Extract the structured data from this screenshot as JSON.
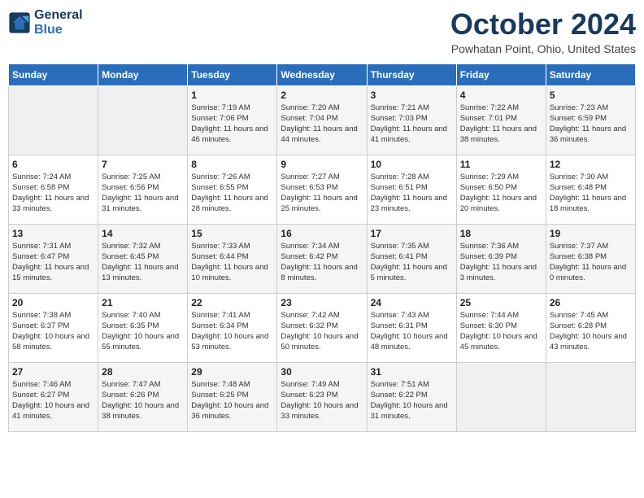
{
  "header": {
    "logo_line1": "General",
    "logo_line2": "Blue",
    "month": "October 2024",
    "location": "Powhatan Point, Ohio, United States"
  },
  "days_of_week": [
    "Sunday",
    "Monday",
    "Tuesday",
    "Wednesday",
    "Thursday",
    "Friday",
    "Saturday"
  ],
  "weeks": [
    [
      {
        "day": "",
        "info": ""
      },
      {
        "day": "",
        "info": ""
      },
      {
        "day": "1",
        "info": "Sunrise: 7:19 AM\nSunset: 7:06 PM\nDaylight: 11 hours and 46 minutes."
      },
      {
        "day": "2",
        "info": "Sunrise: 7:20 AM\nSunset: 7:04 PM\nDaylight: 11 hours and 44 minutes."
      },
      {
        "day": "3",
        "info": "Sunrise: 7:21 AM\nSunset: 7:03 PM\nDaylight: 11 hours and 41 minutes."
      },
      {
        "day": "4",
        "info": "Sunrise: 7:22 AM\nSunset: 7:01 PM\nDaylight: 11 hours and 38 minutes."
      },
      {
        "day": "5",
        "info": "Sunrise: 7:23 AM\nSunset: 6:59 PM\nDaylight: 11 hours and 36 minutes."
      }
    ],
    [
      {
        "day": "6",
        "info": "Sunrise: 7:24 AM\nSunset: 6:58 PM\nDaylight: 11 hours and 33 minutes."
      },
      {
        "day": "7",
        "info": "Sunrise: 7:25 AM\nSunset: 6:56 PM\nDaylight: 11 hours and 31 minutes."
      },
      {
        "day": "8",
        "info": "Sunrise: 7:26 AM\nSunset: 6:55 PM\nDaylight: 11 hours and 28 minutes."
      },
      {
        "day": "9",
        "info": "Sunrise: 7:27 AM\nSunset: 6:53 PM\nDaylight: 11 hours and 25 minutes."
      },
      {
        "day": "10",
        "info": "Sunrise: 7:28 AM\nSunset: 6:51 PM\nDaylight: 11 hours and 23 minutes."
      },
      {
        "day": "11",
        "info": "Sunrise: 7:29 AM\nSunset: 6:50 PM\nDaylight: 11 hours and 20 minutes."
      },
      {
        "day": "12",
        "info": "Sunrise: 7:30 AM\nSunset: 6:48 PM\nDaylight: 11 hours and 18 minutes."
      }
    ],
    [
      {
        "day": "13",
        "info": "Sunrise: 7:31 AM\nSunset: 6:47 PM\nDaylight: 11 hours and 15 minutes."
      },
      {
        "day": "14",
        "info": "Sunrise: 7:32 AM\nSunset: 6:45 PM\nDaylight: 11 hours and 13 minutes."
      },
      {
        "day": "15",
        "info": "Sunrise: 7:33 AM\nSunset: 6:44 PM\nDaylight: 11 hours and 10 minutes."
      },
      {
        "day": "16",
        "info": "Sunrise: 7:34 AM\nSunset: 6:42 PM\nDaylight: 11 hours and 8 minutes."
      },
      {
        "day": "17",
        "info": "Sunrise: 7:35 AM\nSunset: 6:41 PM\nDaylight: 11 hours and 5 minutes."
      },
      {
        "day": "18",
        "info": "Sunrise: 7:36 AM\nSunset: 6:39 PM\nDaylight: 11 hours and 3 minutes."
      },
      {
        "day": "19",
        "info": "Sunrise: 7:37 AM\nSunset: 6:38 PM\nDaylight: 11 hours and 0 minutes."
      }
    ],
    [
      {
        "day": "20",
        "info": "Sunrise: 7:38 AM\nSunset: 6:37 PM\nDaylight: 10 hours and 58 minutes."
      },
      {
        "day": "21",
        "info": "Sunrise: 7:40 AM\nSunset: 6:35 PM\nDaylight: 10 hours and 55 minutes."
      },
      {
        "day": "22",
        "info": "Sunrise: 7:41 AM\nSunset: 6:34 PM\nDaylight: 10 hours and 53 minutes."
      },
      {
        "day": "23",
        "info": "Sunrise: 7:42 AM\nSunset: 6:32 PM\nDaylight: 10 hours and 50 minutes."
      },
      {
        "day": "24",
        "info": "Sunrise: 7:43 AM\nSunset: 6:31 PM\nDaylight: 10 hours and 48 minutes."
      },
      {
        "day": "25",
        "info": "Sunrise: 7:44 AM\nSunset: 6:30 PM\nDaylight: 10 hours and 45 minutes."
      },
      {
        "day": "26",
        "info": "Sunrise: 7:45 AM\nSunset: 6:28 PM\nDaylight: 10 hours and 43 minutes."
      }
    ],
    [
      {
        "day": "27",
        "info": "Sunrise: 7:46 AM\nSunset: 6:27 PM\nDaylight: 10 hours and 41 minutes."
      },
      {
        "day": "28",
        "info": "Sunrise: 7:47 AM\nSunset: 6:26 PM\nDaylight: 10 hours and 38 minutes."
      },
      {
        "day": "29",
        "info": "Sunrise: 7:48 AM\nSunset: 6:25 PM\nDaylight: 10 hours and 36 minutes."
      },
      {
        "day": "30",
        "info": "Sunrise: 7:49 AM\nSunset: 6:23 PM\nDaylight: 10 hours and 33 minutes."
      },
      {
        "day": "31",
        "info": "Sunrise: 7:51 AM\nSunset: 6:22 PM\nDaylight: 10 hours and 31 minutes."
      },
      {
        "day": "",
        "info": ""
      },
      {
        "day": "",
        "info": ""
      }
    ]
  ]
}
